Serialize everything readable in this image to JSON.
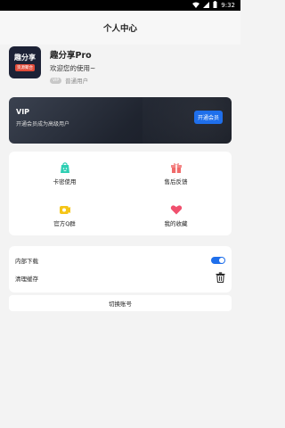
{
  "statusbar": {
    "time": "9:32"
  },
  "header": {
    "title": "个人中心"
  },
  "profile": {
    "logo_text": "趣分享",
    "logo_subtext": "资源聚合",
    "app_name": "趣分享Pro",
    "welcome": "欢迎您的使用~",
    "vip_badge": "VIP",
    "level": "普通用户"
  },
  "vip_card": {
    "title": "VIP",
    "subtitle": "开通会员成为高级用户",
    "button": "开通会员"
  },
  "grid": [
    {
      "label": "卡密使用",
      "icon": "bag-icon",
      "color": "#2ecfb3"
    },
    {
      "label": "售后反馈",
      "icon": "gift-icon",
      "color": "#f06a6a"
    },
    {
      "label": "官方Q群",
      "icon": "qq-group-icon",
      "color": "#f5c518"
    },
    {
      "label": "我的收藏",
      "icon": "heart-icon",
      "color": "#f0506e"
    }
  ],
  "settings": {
    "download_label": "内部下载",
    "download_enabled": true,
    "clear_cache_label": "清理缓存"
  },
  "switch_account": "切换账号",
  "colors": {
    "accent": "#1f6feb"
  }
}
